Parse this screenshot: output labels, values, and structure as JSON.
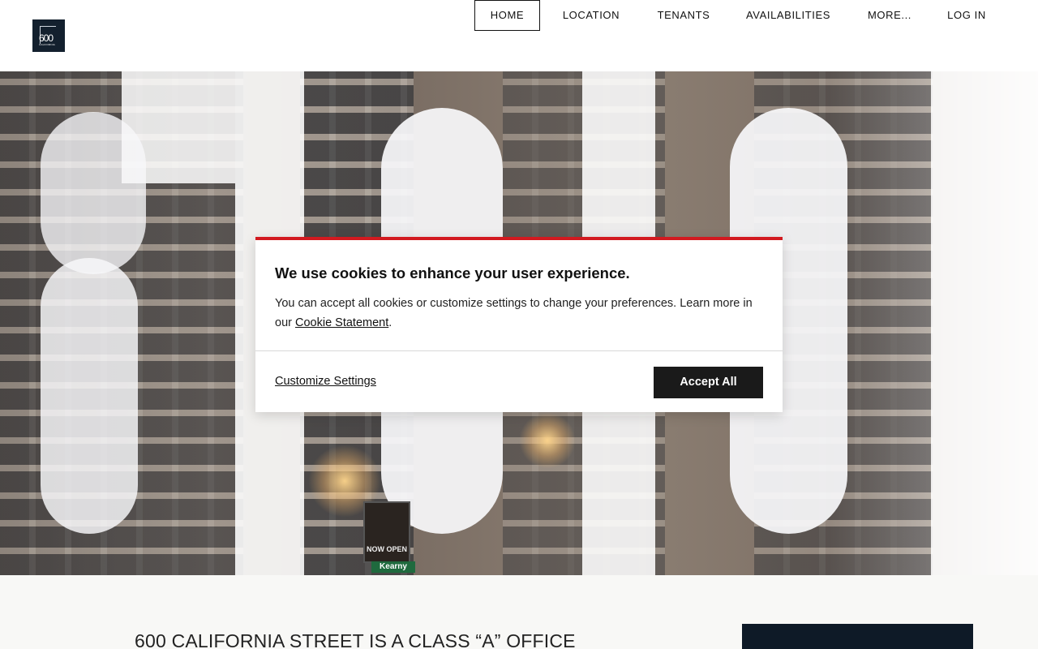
{
  "header": {
    "logo": {
      "number": "600",
      "subtext": "CALIFORNIA",
      "icon": "building-logo-icon"
    },
    "nav": [
      {
        "label": "HOME",
        "active": true
      },
      {
        "label": "LOCATION",
        "active": false
      },
      {
        "label": "TENANTS",
        "active": false
      },
      {
        "label": "AVAILABILITIES",
        "active": false
      },
      {
        "label": "MORE...",
        "active": false
      },
      {
        "label": "LOG IN",
        "active": false
      }
    ]
  },
  "hero": {
    "sign_text": "NOW OPEN",
    "street_sign": "Kearny"
  },
  "cookie_banner": {
    "title": "We use cookies to enhance your user experience.",
    "body": "You can accept all cookies or customize settings to change your preferences. Learn more in our",
    "link_label": "Cookie Statement",
    "link_suffix": ".",
    "customize_label": "Customize Settings",
    "accept_label": "Accept All",
    "accent_color": "#d21a20"
  },
  "content": {
    "headline": "600 CALIFORNIA STREET IS A CLASS “A” OFFICE"
  }
}
